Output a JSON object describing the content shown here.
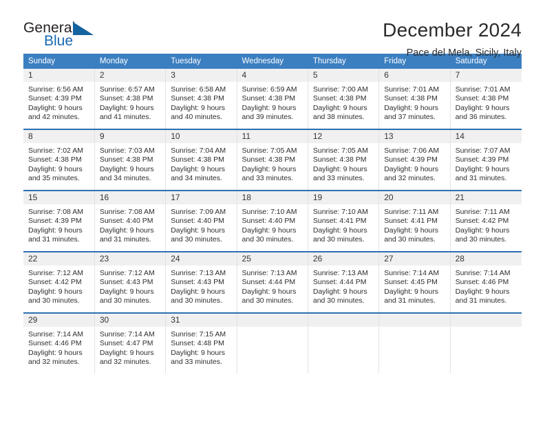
{
  "logo": {
    "primary_text": "General",
    "secondary_text": "Blue",
    "triangle_icon": "blue-triangle-icon",
    "primary_color": "#231f20",
    "secondary_color": "#1668b3"
  },
  "header": {
    "title": "December 2024",
    "subtitle": "Pace del Mela, Sicily, Italy"
  },
  "theme": {
    "header_bg": "#3c7fc1",
    "header_text": "#ffffff",
    "row_divider": "#2b6fb0",
    "daynum_bg": "#f0f0f0"
  },
  "calendar": {
    "weekday_headers": [
      "Sunday",
      "Monday",
      "Tuesday",
      "Wednesday",
      "Thursday",
      "Friday",
      "Saturday"
    ],
    "weeks": [
      [
        {
          "day": "1",
          "sunrise": "Sunrise: 6:56 AM",
          "sunset": "Sunset: 4:39 PM",
          "daylight_line1": "Daylight: 9 hours",
          "daylight_line2": "and 42 minutes."
        },
        {
          "day": "2",
          "sunrise": "Sunrise: 6:57 AM",
          "sunset": "Sunset: 4:38 PM",
          "daylight_line1": "Daylight: 9 hours",
          "daylight_line2": "and 41 minutes."
        },
        {
          "day": "3",
          "sunrise": "Sunrise: 6:58 AM",
          "sunset": "Sunset: 4:38 PM",
          "daylight_line1": "Daylight: 9 hours",
          "daylight_line2": "and 40 minutes."
        },
        {
          "day": "4",
          "sunrise": "Sunrise: 6:59 AM",
          "sunset": "Sunset: 4:38 PM",
          "daylight_line1": "Daylight: 9 hours",
          "daylight_line2": "and 39 minutes."
        },
        {
          "day": "5",
          "sunrise": "Sunrise: 7:00 AM",
          "sunset": "Sunset: 4:38 PM",
          "daylight_line1": "Daylight: 9 hours",
          "daylight_line2": "and 38 minutes."
        },
        {
          "day": "6",
          "sunrise": "Sunrise: 7:01 AM",
          "sunset": "Sunset: 4:38 PM",
          "daylight_line1": "Daylight: 9 hours",
          "daylight_line2": "and 37 minutes."
        },
        {
          "day": "7",
          "sunrise": "Sunrise: 7:01 AM",
          "sunset": "Sunset: 4:38 PM",
          "daylight_line1": "Daylight: 9 hours",
          "daylight_line2": "and 36 minutes."
        }
      ],
      [
        {
          "day": "8",
          "sunrise": "Sunrise: 7:02 AM",
          "sunset": "Sunset: 4:38 PM",
          "daylight_line1": "Daylight: 9 hours",
          "daylight_line2": "and 35 minutes."
        },
        {
          "day": "9",
          "sunrise": "Sunrise: 7:03 AM",
          "sunset": "Sunset: 4:38 PM",
          "daylight_line1": "Daylight: 9 hours",
          "daylight_line2": "and 34 minutes."
        },
        {
          "day": "10",
          "sunrise": "Sunrise: 7:04 AM",
          "sunset": "Sunset: 4:38 PM",
          "daylight_line1": "Daylight: 9 hours",
          "daylight_line2": "and 34 minutes."
        },
        {
          "day": "11",
          "sunrise": "Sunrise: 7:05 AM",
          "sunset": "Sunset: 4:38 PM",
          "daylight_line1": "Daylight: 9 hours",
          "daylight_line2": "and 33 minutes."
        },
        {
          "day": "12",
          "sunrise": "Sunrise: 7:05 AM",
          "sunset": "Sunset: 4:38 PM",
          "daylight_line1": "Daylight: 9 hours",
          "daylight_line2": "and 33 minutes."
        },
        {
          "day": "13",
          "sunrise": "Sunrise: 7:06 AM",
          "sunset": "Sunset: 4:39 PM",
          "daylight_line1": "Daylight: 9 hours",
          "daylight_line2": "and 32 minutes."
        },
        {
          "day": "14",
          "sunrise": "Sunrise: 7:07 AM",
          "sunset": "Sunset: 4:39 PM",
          "daylight_line1": "Daylight: 9 hours",
          "daylight_line2": "and 31 minutes."
        }
      ],
      [
        {
          "day": "15",
          "sunrise": "Sunrise: 7:08 AM",
          "sunset": "Sunset: 4:39 PM",
          "daylight_line1": "Daylight: 9 hours",
          "daylight_line2": "and 31 minutes."
        },
        {
          "day": "16",
          "sunrise": "Sunrise: 7:08 AM",
          "sunset": "Sunset: 4:40 PM",
          "daylight_line1": "Daylight: 9 hours",
          "daylight_line2": "and 31 minutes."
        },
        {
          "day": "17",
          "sunrise": "Sunrise: 7:09 AM",
          "sunset": "Sunset: 4:40 PM",
          "daylight_line1": "Daylight: 9 hours",
          "daylight_line2": "and 30 minutes."
        },
        {
          "day": "18",
          "sunrise": "Sunrise: 7:10 AM",
          "sunset": "Sunset: 4:40 PM",
          "daylight_line1": "Daylight: 9 hours",
          "daylight_line2": "and 30 minutes."
        },
        {
          "day": "19",
          "sunrise": "Sunrise: 7:10 AM",
          "sunset": "Sunset: 4:41 PM",
          "daylight_line1": "Daylight: 9 hours",
          "daylight_line2": "and 30 minutes."
        },
        {
          "day": "20",
          "sunrise": "Sunrise: 7:11 AM",
          "sunset": "Sunset: 4:41 PM",
          "daylight_line1": "Daylight: 9 hours",
          "daylight_line2": "and 30 minutes."
        },
        {
          "day": "21",
          "sunrise": "Sunrise: 7:11 AM",
          "sunset": "Sunset: 4:42 PM",
          "daylight_line1": "Daylight: 9 hours",
          "daylight_line2": "and 30 minutes."
        }
      ],
      [
        {
          "day": "22",
          "sunrise": "Sunrise: 7:12 AM",
          "sunset": "Sunset: 4:42 PM",
          "daylight_line1": "Daylight: 9 hours",
          "daylight_line2": "and 30 minutes."
        },
        {
          "day": "23",
          "sunrise": "Sunrise: 7:12 AM",
          "sunset": "Sunset: 4:43 PM",
          "daylight_line1": "Daylight: 9 hours",
          "daylight_line2": "and 30 minutes."
        },
        {
          "day": "24",
          "sunrise": "Sunrise: 7:13 AM",
          "sunset": "Sunset: 4:43 PM",
          "daylight_line1": "Daylight: 9 hours",
          "daylight_line2": "and 30 minutes."
        },
        {
          "day": "25",
          "sunrise": "Sunrise: 7:13 AM",
          "sunset": "Sunset: 4:44 PM",
          "daylight_line1": "Daylight: 9 hours",
          "daylight_line2": "and 30 minutes."
        },
        {
          "day": "26",
          "sunrise": "Sunrise: 7:13 AM",
          "sunset": "Sunset: 4:44 PM",
          "daylight_line1": "Daylight: 9 hours",
          "daylight_line2": "and 30 minutes."
        },
        {
          "day": "27",
          "sunrise": "Sunrise: 7:14 AM",
          "sunset": "Sunset: 4:45 PM",
          "daylight_line1": "Daylight: 9 hours",
          "daylight_line2": "and 31 minutes."
        },
        {
          "day": "28",
          "sunrise": "Sunrise: 7:14 AM",
          "sunset": "Sunset: 4:46 PM",
          "daylight_line1": "Daylight: 9 hours",
          "daylight_line2": "and 31 minutes."
        }
      ],
      [
        {
          "day": "29",
          "sunrise": "Sunrise: 7:14 AM",
          "sunset": "Sunset: 4:46 PM",
          "daylight_line1": "Daylight: 9 hours",
          "daylight_line2": "and 32 minutes."
        },
        {
          "day": "30",
          "sunrise": "Sunrise: 7:14 AM",
          "sunset": "Sunset: 4:47 PM",
          "daylight_line1": "Daylight: 9 hours",
          "daylight_line2": "and 32 minutes."
        },
        {
          "day": "31",
          "sunrise": "Sunrise: 7:15 AM",
          "sunset": "Sunset: 4:48 PM",
          "daylight_line1": "Daylight: 9 hours",
          "daylight_line2": "and 33 minutes."
        },
        {
          "day": "",
          "sunrise": "",
          "sunset": "",
          "daylight_line1": "",
          "daylight_line2": ""
        },
        {
          "day": "",
          "sunrise": "",
          "sunset": "",
          "daylight_line1": "",
          "daylight_line2": ""
        },
        {
          "day": "",
          "sunrise": "",
          "sunset": "",
          "daylight_line1": "",
          "daylight_line2": ""
        },
        {
          "day": "",
          "sunrise": "",
          "sunset": "",
          "daylight_line1": "",
          "daylight_line2": ""
        }
      ]
    ]
  }
}
